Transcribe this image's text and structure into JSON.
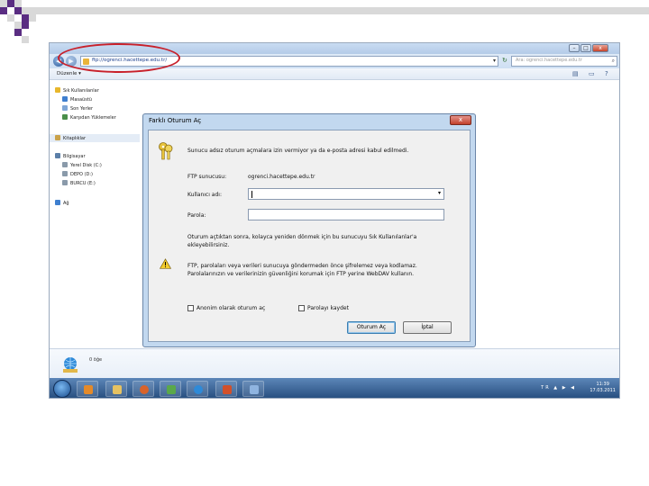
{
  "window": {
    "title": "Farklı Oturum Aç",
    "min": "–",
    "max": "□",
    "close": "x"
  },
  "address": {
    "url": "ftp://ogrenci.hacettepe.edu.tr/",
    "dropdown": "▾",
    "refresh": "↻",
    "search_placeholder": "Ara: ogrenci.hacettepe.edu.tr",
    "search_icon": "⌕"
  },
  "toolbar": {
    "organize": "Düzenle ▾",
    "view_icon": "▤",
    "help_icon": "?"
  },
  "nav": {
    "favorites": "Sık Kullanılanlar",
    "desktop": "Masaüstü",
    "recent": "Son Yerler",
    "downloads": "Karşıdan Yüklemeler",
    "libraries": "Kitaplıklar",
    "computer": "Bilgisayar",
    "local_disk": "Yerel Disk (C:)",
    "depo": "DEPO (D:)",
    "burcu": "BURCU (E:)",
    "network": "Ağ"
  },
  "status": {
    "item_count": "0 öğe"
  },
  "taskbar": {
    "tray": "TR ▲ ▶ ◀ ",
    "time": "11:39",
    "date": "17.03.2011"
  },
  "dialog": {
    "title": "Farklı Oturum Aç",
    "close": "x",
    "message1": "Sunucu adsız oturum açmalara izin vermiyor ya da e-posta adresi kabul edilmedi.",
    "ftp_server_label": "FTP sunucusu:",
    "ftp_server_value": "ogrenci.hacettepe.edu.tr",
    "username_label": "Kullanıcı adı:",
    "username_value": "",
    "password_label": "Parola:",
    "password_value": "",
    "info_line1": "Oturum açtıktan sonra, kolayca yeniden dönmek için bu sunucuyu Sık Kullanılanlar'a",
    "info_line2": "ekleyebilirsiniz.",
    "warning_line1": "FTP, parolaları veya verileri sunucuya göndermeden önce şifrelemez veya kodlamaz.",
    "warning_line2": "Parolalarınızın ve verilerinizin güvenliğini korumak için FTP yerine WebDAV kullanın.",
    "anonymous_label": "Anonim olarak oturum aç",
    "save_password_label": "Parolayı kaydet",
    "login_button": "Oturum Aç",
    "cancel_button": "İptal"
  },
  "colors": {
    "annotation": "#c8202a",
    "square_light": "#d9d9d9",
    "square_dark": "#5a2d82"
  }
}
